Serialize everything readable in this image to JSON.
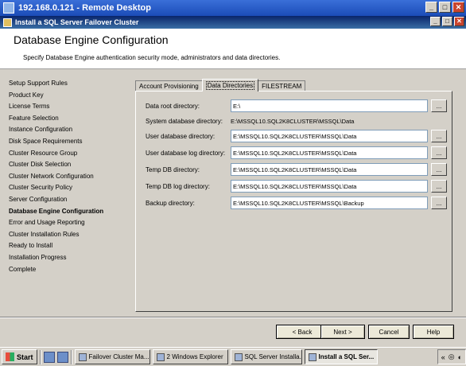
{
  "remote_title": "192.168.0.121 - Remote Desktop",
  "window_title": "Install a SQL Server Failover Cluster",
  "window_buttons": {
    "minimize": "_",
    "maximize": "□",
    "close": "✕"
  },
  "header": {
    "title": "Database Engine Configuration",
    "description": "Specify Database Engine authentication security mode, administrators and data directories."
  },
  "nav": [
    "Setup Support Rules",
    "Product Key",
    "License Terms",
    "Feature Selection",
    "Instance Configuration",
    "Disk Space Requirements",
    "Cluster Resource Group",
    "Cluster Disk Selection",
    "Cluster Network Configuration",
    "Cluster Security Policy",
    "Server Configuration",
    "Database Engine Configuration",
    "Error and Usage Reporting",
    "Cluster Installation Rules",
    "Ready to Install",
    "Installation Progress",
    "Complete"
  ],
  "tabs": [
    "Account Provisioning",
    "Data Directories",
    "FILESTREAM"
  ],
  "fields": [
    {
      "label": "Data root directory:",
      "value": "E:\\"
    },
    {
      "label": "System database directory:",
      "value": "E:\\MSSQL10.SQL2K8CLUSTER\\MSSQL\\Data"
    },
    {
      "label": "User database directory:",
      "value": "E:\\MSSQL10.SQL2K8CLUSTER\\MSSQL\\Data"
    },
    {
      "label": "User database log directory:",
      "value": "E:\\MSSQL10.SQL2K8CLUSTER\\MSSQL\\Data"
    },
    {
      "label": "Temp DB directory:",
      "value": "E:\\MSSQL10.SQL2K8CLUSTER\\MSSQL\\Data"
    },
    {
      "label": "Temp DB log directory:",
      "value": "E:\\MSSQL10.SQL2K8CLUSTER\\MSSQL\\Data"
    },
    {
      "label": "Backup directory:",
      "value": "E:\\MSSQL10.SQL2K8CLUSTER\\MSSQL\\Backup"
    }
  ],
  "browse_label": "...",
  "buttons": {
    "back": "< Back",
    "next": "Next >",
    "cancel": "Cancel",
    "help": "Help"
  },
  "taskbar": {
    "start": "Start",
    "tasks": [
      "Failover Cluster Ma...",
      "2 Windows Explorer",
      "SQL Server Installa...",
      "Install a SQL Ser..."
    ]
  }
}
